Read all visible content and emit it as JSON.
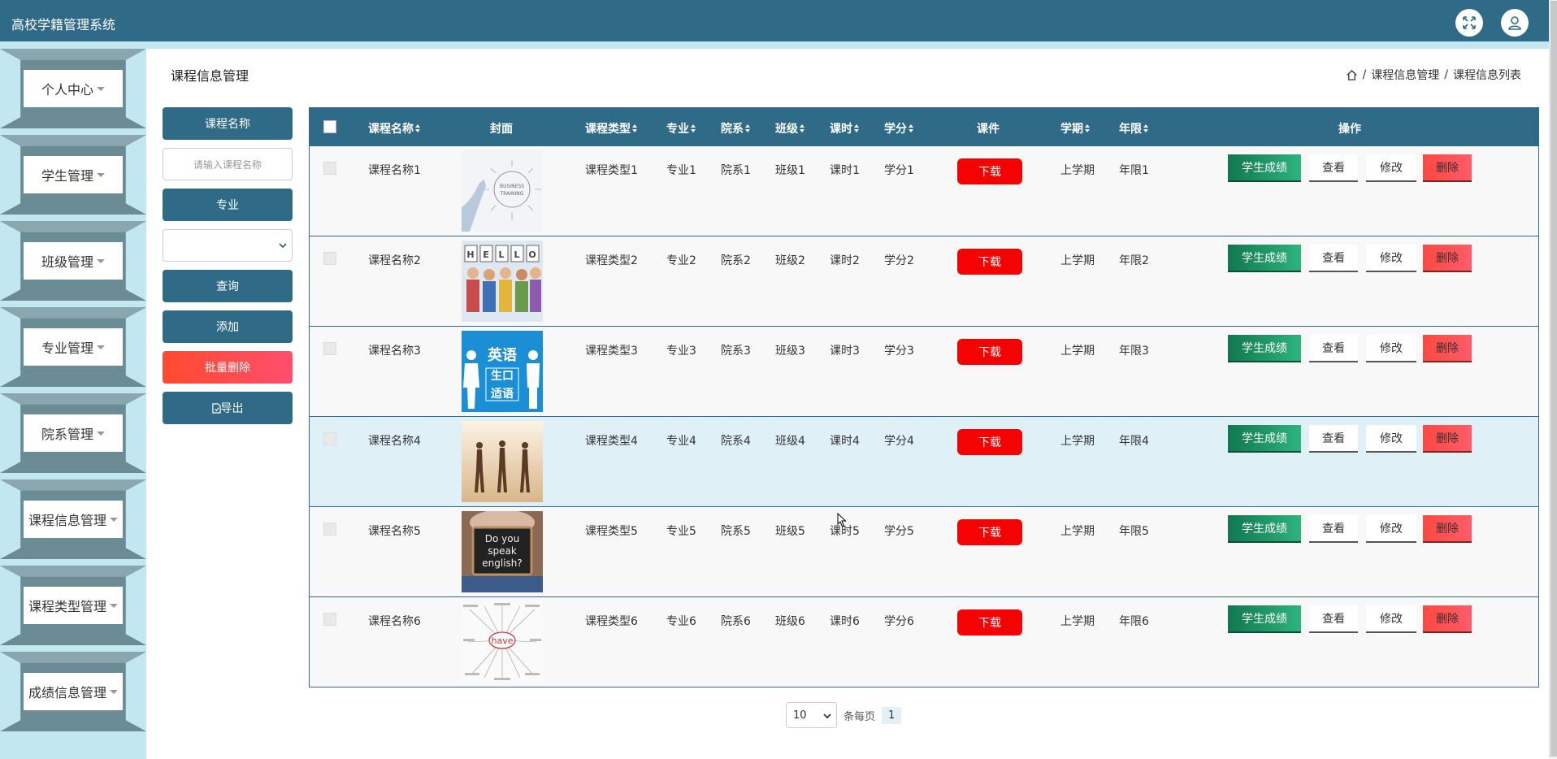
{
  "header": {
    "title": "高校学籍管理系统",
    "icons": [
      "fullscreen-icon",
      "user-icon"
    ]
  },
  "sidebar": {
    "items": [
      {
        "label": "个人中心"
      },
      {
        "label": "学生管理"
      },
      {
        "label": "班级管理"
      },
      {
        "label": "专业管理"
      },
      {
        "label": "院系管理"
      },
      {
        "label": "课程信息管理"
      },
      {
        "label": "课程类型管理"
      },
      {
        "label": "成绩信息管理"
      }
    ]
  },
  "page": {
    "heading": "课程信息管理",
    "breadcrumb": [
      "课程信息管理",
      "课程信息列表"
    ],
    "breadcrumb_sep": "/"
  },
  "filters": {
    "course_name_label": "课程名称",
    "course_name_placeholder": "请输入课程名称",
    "major_label": "专业",
    "query_label": "查询",
    "add_label": "添加",
    "batch_delete_label": "批量删除",
    "export_label": "导出"
  },
  "table": {
    "headers": [
      "课程名称",
      "封面",
      "课程类型",
      "专业",
      "院系",
      "班级",
      "课时",
      "学分",
      "课件",
      "学期",
      "年限",
      "操作"
    ],
    "rows": [
      {
        "name": "课程名称1",
        "cover": "business training sketch",
        "type": "课程类型1",
        "major": "专业1",
        "dept": "院系1",
        "class": "班级1",
        "hours": "课时1",
        "credit": "学分1",
        "semester": "上学期",
        "years": "年限1"
      },
      {
        "name": "课程名称2",
        "cover": "hello children",
        "type": "课程类型2",
        "major": "专业2",
        "dept": "院系2",
        "class": "班级2",
        "hours": "课时2",
        "credit": "学分2",
        "semester": "上学期",
        "years": "年限2"
      },
      {
        "name": "课程名称3",
        "cover": "英语 生口 适语",
        "type": "课程类型3",
        "major": "专业3",
        "dept": "院系3",
        "class": "班级3",
        "hours": "课时3",
        "credit": "学分3",
        "semester": "上学期",
        "years": "年限3"
      },
      {
        "name": "课程名称4",
        "cover": "dancers",
        "type": "课程类型4",
        "major": "专业4",
        "dept": "院系4",
        "class": "班级4",
        "hours": "课时4",
        "credit": "学分4",
        "semester": "上学期",
        "years": "年限4"
      },
      {
        "name": "课程名称5",
        "cover": "Do you speak english?",
        "type": "课程类型5",
        "major": "专业5",
        "dept": "院系5",
        "class": "班级5",
        "hours": "课时5",
        "credit": "学分5",
        "semester": "上学期",
        "years": "年限5"
      },
      {
        "name": "课程名称6",
        "cover": "have word map",
        "type": "课程类型6",
        "major": "专业6",
        "dept": "院系6",
        "class": "班级6",
        "hours": "课时6",
        "credit": "学分6",
        "semester": "上学期",
        "years": "年限6"
      }
    ],
    "download_label": "下载",
    "actions": {
      "score": "学生成绩",
      "view": "查看",
      "edit": "修改",
      "delete": "删除"
    },
    "highlighted_row": 4
  },
  "pager": {
    "page_size": "10",
    "per_page_label": "条每页",
    "current_page": "1"
  },
  "colors": {
    "primary": "#2f6b87",
    "accent_light": "#c3e7f0",
    "danger": "#f50202",
    "success": "#11784f"
  }
}
